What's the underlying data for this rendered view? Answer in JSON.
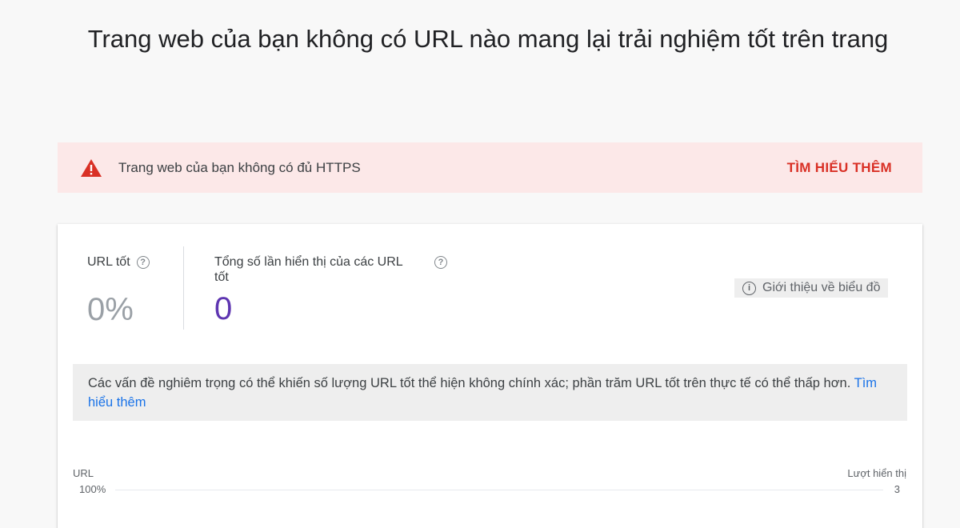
{
  "page": {
    "title": "Trang web của bạn không có URL nào mang lại trải nghiệm tốt trên trang"
  },
  "alert": {
    "icon": "warning-icon",
    "color": "#d93025",
    "text": "Trang web của bạn không có đủ HTTPS",
    "link_label": "TÌM HIỂU THÊM"
  },
  "metrics": {
    "good_urls": {
      "label": "URL tốt",
      "value": "0%"
    },
    "impressions": {
      "label": "Tổng số lần hiển thị của các URL tốt",
      "value": "0",
      "color": "#5e35b1"
    }
  },
  "chart_info_button": {
    "icon": "info-icon",
    "label": "Giới thiệu về biểu đồ"
  },
  "notice": {
    "text": "Các vấn đề nghiêm trọng có thể khiến số lượng URL tốt thể hiện không chính xác; phần trăm URL tốt trên thực tế có thể thấp hơn.",
    "link_label": "Tìm hiểu thêm"
  },
  "chart": {
    "left_axis_title": "URL",
    "left_axis_top_tick": "100%",
    "right_axis_title": "Lượt hiển thị",
    "right_axis_top_tick": "3"
  }
}
